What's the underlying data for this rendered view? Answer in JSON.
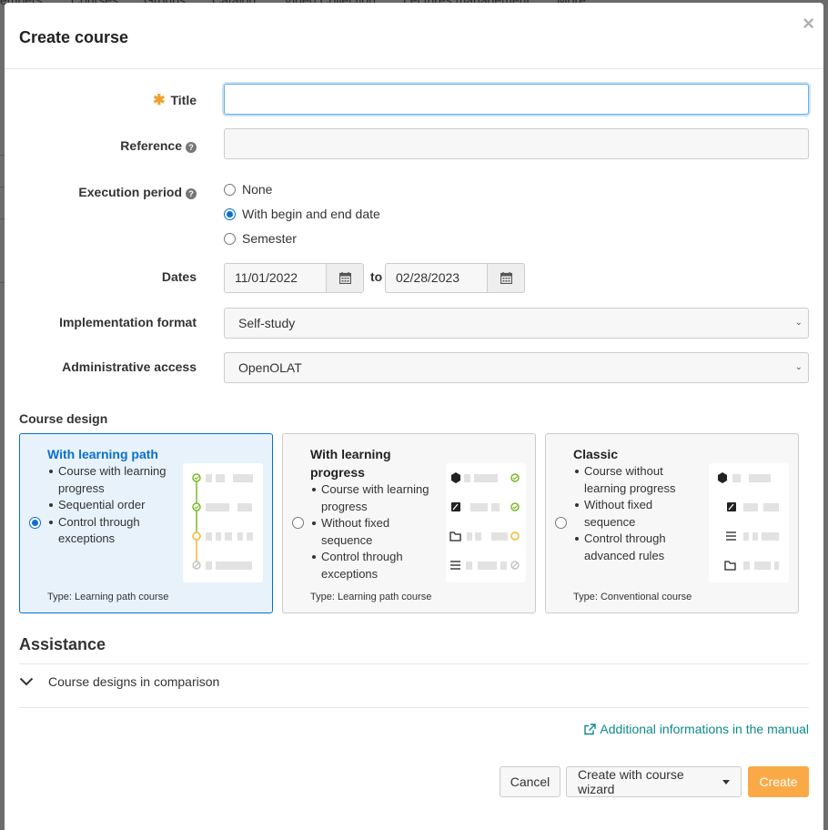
{
  "background_nav": [
    "embers",
    "Courses",
    "Groups",
    "Catalog",
    "Video Collection",
    "Lectures management",
    "More"
  ],
  "dialog": {
    "title": "Create course",
    "close_label": "×"
  },
  "form": {
    "title_label": "Title",
    "title_value": "",
    "reference_label": "Reference",
    "reference_value": "",
    "execution_label": "Execution period",
    "execution_options": [
      {
        "label": "None",
        "selected": false
      },
      {
        "label": "With begin and end date",
        "selected": true
      },
      {
        "label": "Semester",
        "selected": false
      }
    ],
    "dates_label": "Dates",
    "date_from": "11/01/2022",
    "date_to_label": "to",
    "date_to": "02/28/2023",
    "implementation_label": "Implementation format",
    "implementation_value": "Self-study",
    "admin_label": "Administrative access",
    "admin_value": "OpenOLAT"
  },
  "course_design": {
    "title": "Course design",
    "cards": [
      {
        "title": "With learning path",
        "bullets": [
          "Course with learning progress",
          "Sequential order",
          "Control through exceptions"
        ],
        "type": "Type: Learning path course",
        "selected": true
      },
      {
        "title": "With learning progress",
        "bullets": [
          "Course with learning progress",
          "Without fixed sequence",
          "Control through exceptions"
        ],
        "type": "Type: Learning path course",
        "selected": false
      },
      {
        "title": "Classic",
        "bullets": [
          "Course without learning progress",
          "Without fixed sequence",
          "Control through advanced rules"
        ],
        "type": "Type: Conventional course",
        "selected": false
      }
    ]
  },
  "assistance": {
    "title": "Assistance",
    "comparison_label": "Course designs in comparison",
    "manual_link": "Additional informations in the manual"
  },
  "buttons": {
    "cancel": "Cancel",
    "wizard": "Create with course wizard",
    "create": "Create"
  },
  "colors": {
    "accent": "#0a6fd0",
    "primary_button": "#f9aa47",
    "link": "#0d8a8a",
    "check_green": "#7ab829",
    "pending_orange": "#f5b730"
  }
}
